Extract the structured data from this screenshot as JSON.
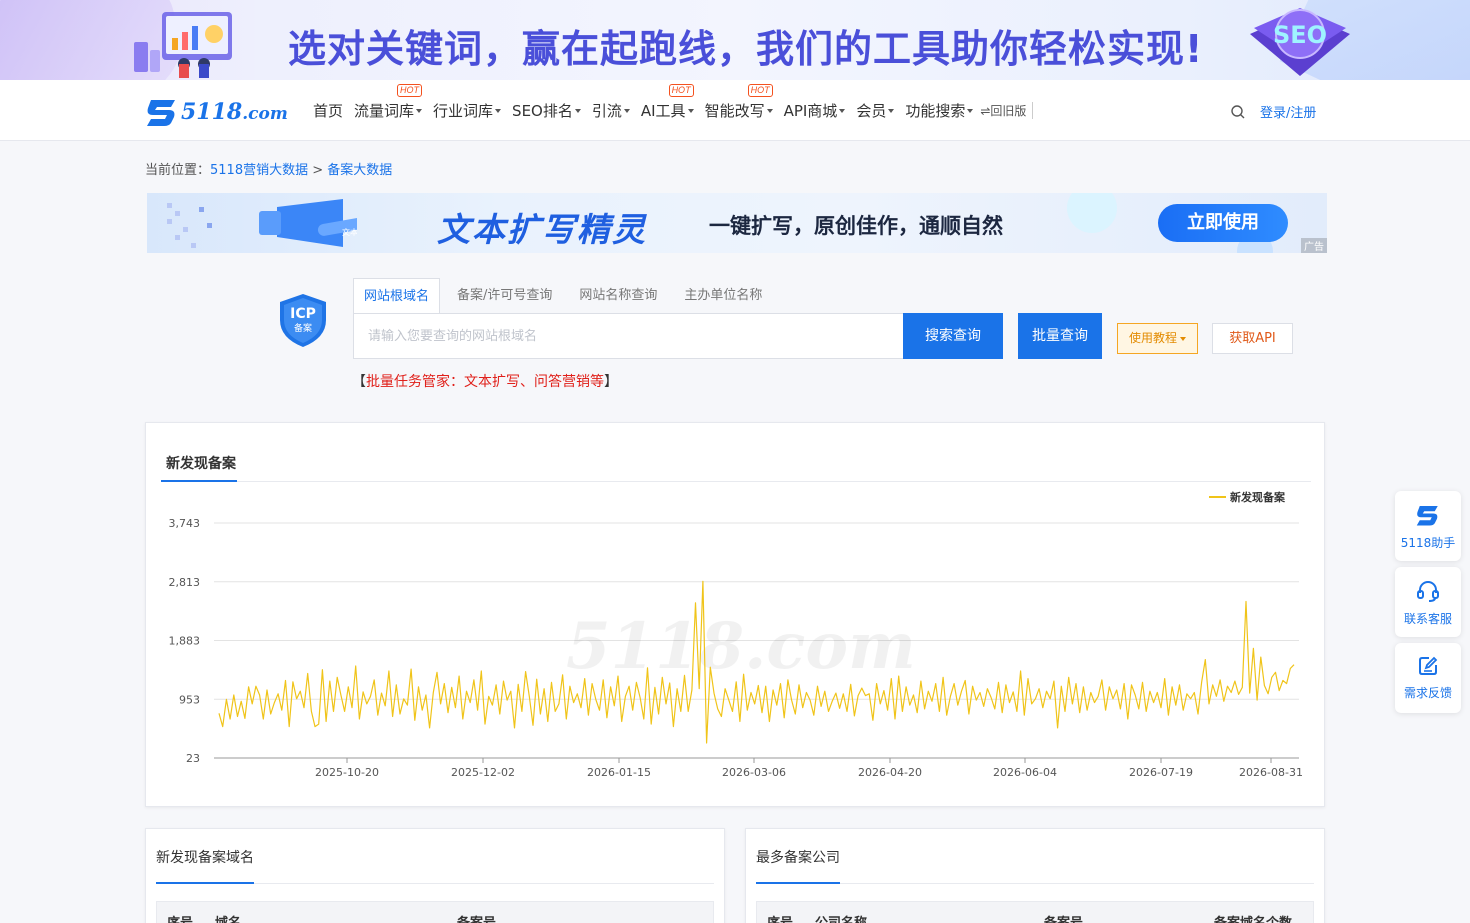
{
  "banner": {
    "slogan": "选对关键词，赢在起跑线，我们的工具助你轻松实现!",
    "badge_text": "SEO"
  },
  "logo": {
    "main": "5118",
    "suffix": ".com"
  },
  "nav": {
    "items": [
      {
        "label": "首页",
        "caret": false,
        "hot": false
      },
      {
        "label": "流量词库",
        "caret": true,
        "hot": true
      },
      {
        "label": "行业词库",
        "caret": true,
        "hot": false
      },
      {
        "label": "SEO排名",
        "caret": true,
        "hot": false
      },
      {
        "label": "引流",
        "caret": true,
        "hot": false
      },
      {
        "label": "AI工具",
        "caret": true,
        "hot": true
      },
      {
        "label": "智能改写",
        "caret": true,
        "hot": true
      },
      {
        "label": "API商城",
        "caret": true,
        "hot": false
      },
      {
        "label": "会员",
        "caret": true,
        "hot": false
      },
      {
        "label": "功能搜索",
        "caret": true,
        "hot": false
      }
    ],
    "hot_label": "HOT",
    "old_version": "⇌回旧版",
    "login": "登录/注册"
  },
  "breadcrumb": {
    "prefix": "当前位置：",
    "home": "5118营销大数据",
    "sep": ">",
    "current": "备案大数据"
  },
  "ad": {
    "title": "文本扩写精灵",
    "subtitle": "一键扩写，原创佳作，通顺自然",
    "button": "立即使用",
    "tag": "广告",
    "deco_text": "文本扩写"
  },
  "search": {
    "icp_top": "ICP",
    "icp_bottom": "备案",
    "tabs": [
      "网站根域名",
      "备案/许可号查询",
      "网站名称查询",
      "主办单位名称"
    ],
    "active_tab": 0,
    "placeholder": "请输入您要查询的网站根域名",
    "value": "",
    "search_btn": "搜索查询",
    "batch_btn": "批量查询",
    "guide_btn": "使用教程",
    "api_btn": "获取API",
    "promo_open": "【",
    "promo_text": "批量任务管家：文本扩写、问答营销等",
    "promo_close": "】"
  },
  "chart_panel": {
    "title": "新发现备案",
    "watermark": "5118.com"
  },
  "chart_data": {
    "type": "line",
    "series": [
      {
        "name": "新发现备案",
        "color": "#f0c419",
        "values": [
          730,
          520,
          950,
          640,
          1020,
          680,
          920,
          650,
          1150,
          880,
          1160,
          1020,
          640,
          1100,
          720,
          900,
          1040,
          780,
          1250,
          520,
          1230,
          960,
          1080,
          820,
          1360,
          760,
          520,
          560,
          1420,
          600,
          1240,
          760,
          1300,
          1020,
          760,
          1150,
          820,
          1480,
          640,
          1070,
          880,
          1000,
          1260,
          700,
          1050,
          850,
          1400,
          680,
          1180,
          720,
          960,
          860,
          1430,
          620,
          1150,
          780,
          1020,
          500,
          1060,
          1380,
          880,
          1200,
          740,
          1140,
          820,
          1320,
          640,
          1080,
          900,
          1260,
          780,
          1400,
          560,
          1000,
          860,
          1180,
          720,
          1240,
          940,
          1080,
          500,
          1190,
          760,
          1390,
          1000,
          540,
          1270,
          720,
          1120,
          600,
          1220,
          760,
          880,
          1340,
          640,
          1160,
          900,
          1040,
          820,
          1280,
          700,
          1200,
          950,
          780,
          1260,
          660,
          1150,
          850,
          1320,
          600,
          1000,
          1160,
          780,
          1220,
          980,
          640,
          1450,
          560,
          1140,
          720,
          1300,
          880,
          1210,
          520,
          1120,
          760,
          1330,
          760,
          1100,
          2480,
          1120,
          2820,
          260,
          1460,
          1050,
          800,
          680,
          1120,
          940,
          760,
          1230,
          600,
          1350,
          780,
          1060,
          880,
          1170,
          740,
          1160,
          600,
          1100,
          860,
          1200,
          660,
          1260,
          940,
          720,
          1180,
          820,
          1060,
          940,
          700,
          1160,
          840,
          1080,
          760,
          920,
          1050,
          810,
          1040,
          760,
          1190,
          690,
          1010,
          1130,
          1010,
          1040,
          620,
          1200,
          880,
          1090,
          780,
          1280,
          640,
          1320,
          760,
          1150,
          860,
          1020,
          740,
          1240,
          800,
          1080,
          920,
          1200,
          760,
          1300,
          700,
          1000,
          1200,
          860,
          1080,
          1250,
          720,
          1160,
          940,
          1060,
          840,
          1120,
          980,
          800,
          1220,
          740,
          1180,
          900,
          1070,
          760,
          1400,
          700,
          1280,
          880,
          960,
          1120,
          820,
          1080,
          960,
          1240,
          500,
          1160,
          760,
          1300,
          880,
          1200,
          740,
          1150,
          780,
          1060,
          900,
          1000,
          1260,
          780,
          1150,
          960,
          1100,
          800,
          1200,
          640,
          1180,
          1020,
          800,
          1220,
          760,
          1080,
          900,
          1060,
          820,
          1280,
          700,
          1150,
          860,
          1180,
          780,
          1040,
          960,
          1060,
          720,
          1220,
          1580,
          880,
          1180,
          1000,
          1260,
          920,
          1160,
          1060,
          1240,
          1030,
          1140,
          2500,
          1050,
          1760,
          940,
          1620,
          1170,
          1040,
          1300,
          1380,
          1090,
          1250,
          1200,
          1440,
          1500
        ]
      }
    ],
    "x_ticks": [
      "2025-10-20",
      "2025-12-02",
      "2026-01-15",
      "2026-03-06",
      "2026-04-20",
      "2026-06-04",
      "2026-07-19",
      "2026-08-31"
    ],
    "y_ticks": [
      23,
      953,
      1883,
      2813,
      3743
    ],
    "ylim": [
      23,
      3743
    ],
    "legend_position": "top-right",
    "grid": true
  },
  "left_list": {
    "title": "新发现备案域名",
    "headers": [
      "序号",
      "域名",
      "备案号"
    ]
  },
  "right_list": {
    "title": "最多备案公司",
    "headers": [
      "序号",
      "公司名称",
      "备案号",
      "备案域名个数"
    ]
  },
  "side_tools": [
    {
      "label": "5118助手",
      "icon": "logo-icon"
    },
    {
      "label": "联系客服",
      "icon": "headset-icon"
    },
    {
      "label": "需求反馈",
      "icon": "feedback-icon"
    }
  ]
}
